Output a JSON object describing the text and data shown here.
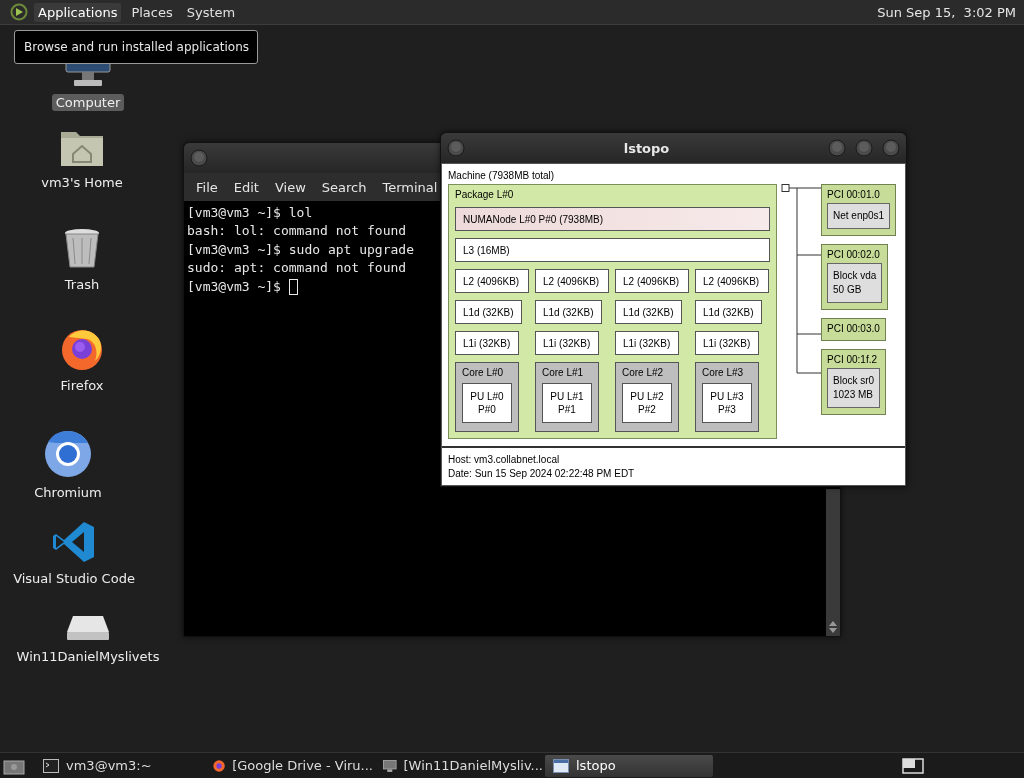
{
  "top_panel": {
    "menus": [
      {
        "label": "Applications",
        "hovered": true
      },
      {
        "label": "Places",
        "hovered": false
      },
      {
        "label": "System",
        "hovered": false
      }
    ],
    "clock": "Sun Sep 15,  3:02 PM"
  },
  "tooltip": "Browse and run installed applications",
  "desktop_icons": [
    {
      "label": "Computer",
      "kind": "computer",
      "selected": true
    },
    {
      "label": "vm3's Home",
      "kind": "home",
      "selected": false
    },
    {
      "label": "Trash",
      "kind": "trash",
      "selected": false
    },
    {
      "label": "Firefox",
      "kind": "firefox",
      "selected": false
    },
    {
      "label": "Chromium",
      "kind": "chromium",
      "selected": false
    },
    {
      "label": "Visual Studio Code",
      "kind": "vscode",
      "selected": false
    },
    {
      "label": "Win11DanielMyslivets",
      "kind": "drive",
      "selected": false
    }
  ],
  "terminal": {
    "menus": [
      "File",
      "Edit",
      "View",
      "Search",
      "Terminal"
    ],
    "lines": [
      "[vm3@vm3 ~]$ lol",
      "bash: lol: command not found",
      "[vm3@vm3 ~]$ sudo apt upgrade",
      "sudo: apt: command not found",
      "[vm3@vm3 ~]$ "
    ]
  },
  "lstopo": {
    "title": "lstopo",
    "machine": "Machine (7938MB total)",
    "package": {
      "label": "Package L#0",
      "numa": "NUMANode L#0 P#0 (7938MB)",
      "l3": "L3 (16MB)",
      "l2": [
        "L2 (4096KB)",
        "L2 (4096KB)",
        "L2 (4096KB)",
        "L2 (4096KB)"
      ],
      "l1d": [
        "L1d (32KB)",
        "L1d (32KB)",
        "L1d (32KB)",
        "L1d (32KB)"
      ],
      "l1i": [
        "L1i (32KB)",
        "L1i (32KB)",
        "L1i (32KB)",
        "L1i (32KB)"
      ],
      "cores": [
        {
          "label": "Core L#0",
          "pu": [
            "PU L#0",
            "P#0"
          ]
        },
        {
          "label": "Core L#1",
          "pu": [
            "PU L#1",
            "P#1"
          ]
        },
        {
          "label": "Core L#2",
          "pu": [
            "PU L#2",
            "P#2"
          ]
        },
        {
          "label": "Core L#3",
          "pu": [
            "PU L#3",
            "P#3"
          ]
        }
      ]
    },
    "pci": [
      {
        "label": "PCI 00:01.0",
        "device": [
          "Net enp0s1"
        ]
      },
      {
        "label": "PCI 00:02.0",
        "device": [
          "Block vda",
          "50 GB"
        ]
      },
      {
        "label": "PCI 00:03.0"
      },
      {
        "label": "PCI 00:1f.2",
        "device": [
          "Block sr0",
          "1023 MB"
        ]
      }
    ],
    "host": "Host: vm3.collabnet.local",
    "date": "Date: Sun 15 Sep 2024 02:22:48 PM EDT"
  },
  "taskbar": [
    {
      "label": "vm3@vm3:~",
      "kind": "terminal",
      "selected": false
    },
    {
      "label": "[Google Drive - Viru...",
      "kind": "firefox",
      "selected": false
    },
    {
      "label": "[Win11DanielMysliv...",
      "kind": "vm",
      "selected": false
    },
    {
      "label": "lstopo",
      "kind": "lstopo",
      "selected": true
    }
  ]
}
